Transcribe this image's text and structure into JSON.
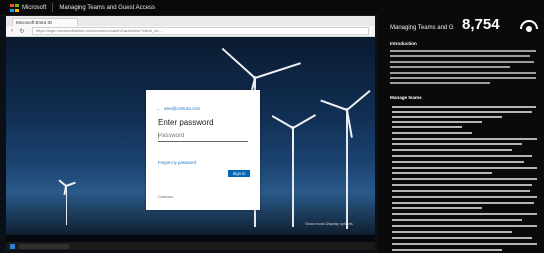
{
  "header": {
    "brand": "Microsoft",
    "title": "Managing Teams and Guest Access"
  },
  "browser": {
    "tab_label": "Microsoft Entra ID",
    "url": "https://login.microsoftonline.com/common/oauth2/authorize?client_id=..."
  },
  "login": {
    "back_glyph": "←",
    "account": "user@contoso.com",
    "heading": "Enter password",
    "password_placeholder": "Password",
    "password_glyph": "|",
    "forgot_link": "Forgot my password",
    "signin_label": "Sign in",
    "footer": "Contoso"
  },
  "vm_overlay": "Show tools   Display options",
  "panel": {
    "title": "Managing Teams and G",
    "count": "8,754",
    "eye_icon": "eye-icon",
    "sections": [
      {
        "label": "Introduction"
      },
      {
        "label": "Manage teams"
      }
    ]
  },
  "colors": {
    "accent_blue": "#0067b8",
    "ms_red": "#f25022",
    "ms_green": "#7fba00",
    "ms_blue": "#00a4ef",
    "ms_yellow": "#ffb900"
  }
}
